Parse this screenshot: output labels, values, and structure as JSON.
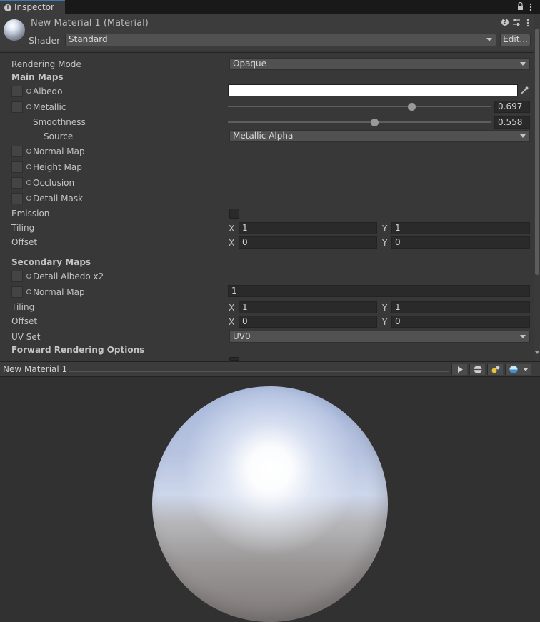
{
  "window": {
    "tab_label": "Inspector",
    "tab_info_glyph": "i"
  },
  "material": {
    "title": "New Material 1 (Material)",
    "shader_label": "Shader",
    "shader_value": "Standard",
    "edit_button": "Edit..."
  },
  "props": {
    "rendering_mode_label": "Rendering Mode",
    "rendering_mode_value": "Opaque",
    "main_maps_header": "Main Maps",
    "albedo_label": "Albedo",
    "albedo_color": "#ffffff",
    "metallic_label": "Metallic",
    "metallic_value": "0.697",
    "smoothness_label": "Smoothness",
    "smoothness_value": "0.558",
    "source_label": "Source",
    "source_value": "Metallic Alpha",
    "normal_map_label": "Normal Map",
    "height_map_label": "Height Map",
    "occlusion_label": "Occlusion",
    "detail_mask_label": "Detail Mask",
    "emission_label": "Emission",
    "tiling_label": "Tiling",
    "offset_label": "Offset",
    "x_label": "X",
    "y_label": "Y",
    "main_tiling_x": "1",
    "main_tiling_y": "1",
    "main_offset_x": "0",
    "main_offset_y": "0",
    "secondary_maps_header": "Secondary Maps",
    "detail_albedo_label": "Detail Albedo x2",
    "sec_normal_map_label": "Normal Map",
    "sec_normal_scale": "1",
    "sec_tiling_x": "1",
    "sec_tiling_y": "1",
    "sec_offset_x": "0",
    "sec_offset_y": "0",
    "uv_set_label": "UV Set",
    "uv_set_value": "UV0",
    "forward_header": "Forward Rendering Options"
  },
  "preview": {
    "title": "New Material 1"
  },
  "icons": {
    "lock": "lock-icon",
    "help": "help-icon",
    "settings": "settings-icon",
    "menu": "menu-icon",
    "eyedropper": "eyedropper-icon",
    "play": "play-icon"
  }
}
